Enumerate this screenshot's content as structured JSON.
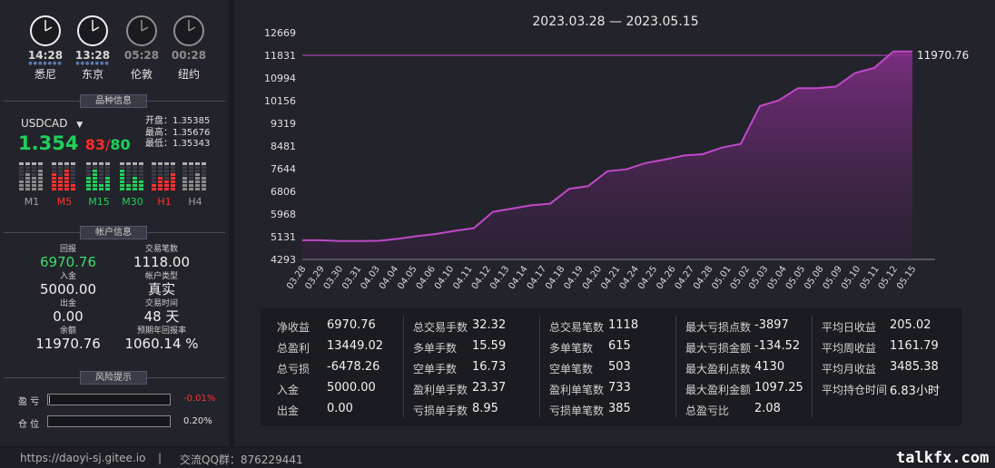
{
  "clocks": [
    {
      "time": "14:28",
      "city": "悉尼",
      "active": true
    },
    {
      "time": "13:28",
      "city": "东京",
      "active": true
    },
    {
      "time": "05:28",
      "city": "伦敦",
      "active": false
    },
    {
      "time": "00:28",
      "city": "纽约",
      "active": false
    }
  ],
  "symbol_section": {
    "title": "品种信息",
    "symbol": "USDCAD",
    "price_main": "1.354",
    "price_big": "83",
    "price_slash": "/",
    "price_small": "80",
    "open": "开盘：1.35385",
    "high": "最高：1.35676",
    "low": "最低：1.35343"
  },
  "timeframes": [
    {
      "label": "M1",
      "color": "#d0d0d0"
    },
    {
      "label": "M5",
      "color": "#ff3030"
    },
    {
      "label": "M15",
      "color": "#1fd05a"
    },
    {
      "label": "M30",
      "color": "#1fd05a"
    },
    {
      "label": "H1",
      "color": "#ff3030"
    },
    {
      "label": "H4",
      "color": "#d0d0d0"
    }
  ],
  "account_section": {
    "title": "帐户信息",
    "items": [
      {
        "label": "回报",
        "value": "6970.76",
        "green": true
      },
      {
        "label": "交易笔数",
        "value": "1118.00"
      },
      {
        "label": "入金",
        "value": "5000.00"
      },
      {
        "label": "帐户类型",
        "value": "真实"
      },
      {
        "label": "出金",
        "value": "0.00"
      },
      {
        "label": "交易时间",
        "value": "48 天"
      },
      {
        "label": "余额",
        "value": "11970.76"
      },
      {
        "label": "预期年回报率",
        "value": "1060.14 %"
      }
    ]
  },
  "risk_section": {
    "title": "风险提示",
    "profit_label": "盈  亏",
    "profit_value": "-0.01%",
    "position_label": "仓  位",
    "position_value": "0.20%"
  },
  "footer": {
    "url": "https://daoyi-sj.gitee.io",
    "sep": "|",
    "qq": "交流QQ群：876229441",
    "watermark": "talkfx.com"
  },
  "chart_data": {
    "type": "area",
    "title": "2023.03.28 — 2023.05.15",
    "y_ticks": [
      "12669",
      "11831",
      "10994",
      "10156",
      "9319",
      "8481",
      "7644",
      "6806",
      "5968",
      "5131",
      "4293"
    ],
    "ylim": [
      4293,
      12669
    ],
    "last_label": "11970.76",
    "x_labels": [
      "03.28",
      "03.29",
      "03.30",
      "03.31",
      "04.03",
      "04.04",
      "04.05",
      "04.06",
      "04.10",
      "04.11",
      "04.12",
      "04.13",
      "04.14",
      "04.17",
      "04.18",
      "04.19",
      "04.20",
      "04.21",
      "04.24",
      "04.25",
      "04.26",
      "04.27",
      "04.28",
      "05.01",
      "05.02",
      "05.03",
      "05.04",
      "05.05",
      "05.08",
      "05.09",
      "05.10",
      "05.11",
      "05.12",
      "05.15"
    ],
    "values": [
      5000,
      5000,
      4970,
      4970,
      4980,
      5050,
      5150,
      5230,
      5350,
      5450,
      6050,
      6170,
      6290,
      6350,
      6900,
      7000,
      7550,
      7620,
      7850,
      7980,
      8130,
      8180,
      8420,
      8560,
      9960,
      10170,
      10620,
      10620,
      10680,
      11180,
      11370,
      11970.76,
      11970.76
    ],
    "line_color": "#c049c8"
  },
  "stats": {
    "rows": [
      [
        [
          "净收益",
          "6970.76"
        ],
        [
          "总交易手数",
          "32.32"
        ],
        [
          "总交易笔数",
          "1118"
        ],
        [
          "最大亏损点数",
          "-3897"
        ],
        [
          "平均日收益",
          "205.02"
        ]
      ],
      [
        [
          "总盈利",
          "13449.02"
        ],
        [
          "多单手数",
          "15.59"
        ],
        [
          "多单笔数",
          "615"
        ],
        [
          "最大亏损金额",
          "-134.52"
        ],
        [
          "平均周收益",
          "1161.79"
        ]
      ],
      [
        [
          "总亏损",
          "-6478.26"
        ],
        [
          "空单手数",
          "16.73"
        ],
        [
          "空单笔数",
          "503"
        ],
        [
          "最大盈利点数",
          "4130"
        ],
        [
          "平均月收益",
          "3485.38"
        ]
      ],
      [
        [
          "入金",
          "5000.00"
        ],
        [
          "盈利单手数",
          "23.37"
        ],
        [
          "盈利单笔数",
          "733"
        ],
        [
          "最大盈利金额",
          "1097.25"
        ],
        [
          "平均持仓时间",
          "6.83小时"
        ]
      ],
      [
        [
          "出金",
          "0.00"
        ],
        [
          "亏损单手数",
          "8.95"
        ],
        [
          "亏损单笔数",
          "385"
        ],
        [
          "总盈亏比",
          "2.08"
        ],
        null
      ]
    ]
  }
}
